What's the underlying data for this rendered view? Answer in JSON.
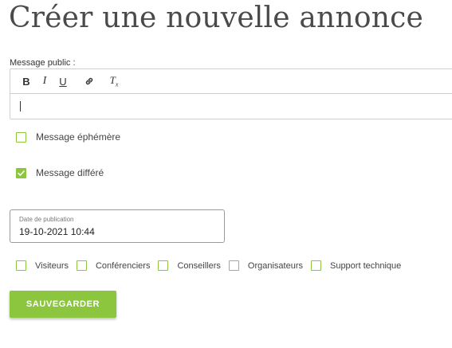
{
  "page": {
    "title": "Créer une nouvelle annonce"
  },
  "editor": {
    "label": "Message public :",
    "toolbar": {
      "bold": "B",
      "italic": "I",
      "underline": "U",
      "link_icon": "link-icon",
      "clear_format": "T",
      "clear_format_sub": "x"
    },
    "content": ""
  },
  "options": {
    "ephemeral": {
      "label": "Message éphémère",
      "checked": false
    },
    "deferred": {
      "label": "Message différé",
      "checked": true
    }
  },
  "date_field": {
    "label": "Date de publication",
    "value": "19-10-2021 10:44"
  },
  "audience": [
    {
      "label": "Visiteurs",
      "checked": false
    },
    {
      "label": "Conférenciers",
      "checked": false
    },
    {
      "label": "Conseillers",
      "checked": false
    },
    {
      "label": "Organisateurs",
      "checked": false
    },
    {
      "label": "Support technique",
      "checked": false
    }
  ],
  "actions": {
    "save_label": "SAUVEGARDER"
  },
  "colors": {
    "accent": "#8cc63f",
    "title": "#4a4a4a"
  }
}
